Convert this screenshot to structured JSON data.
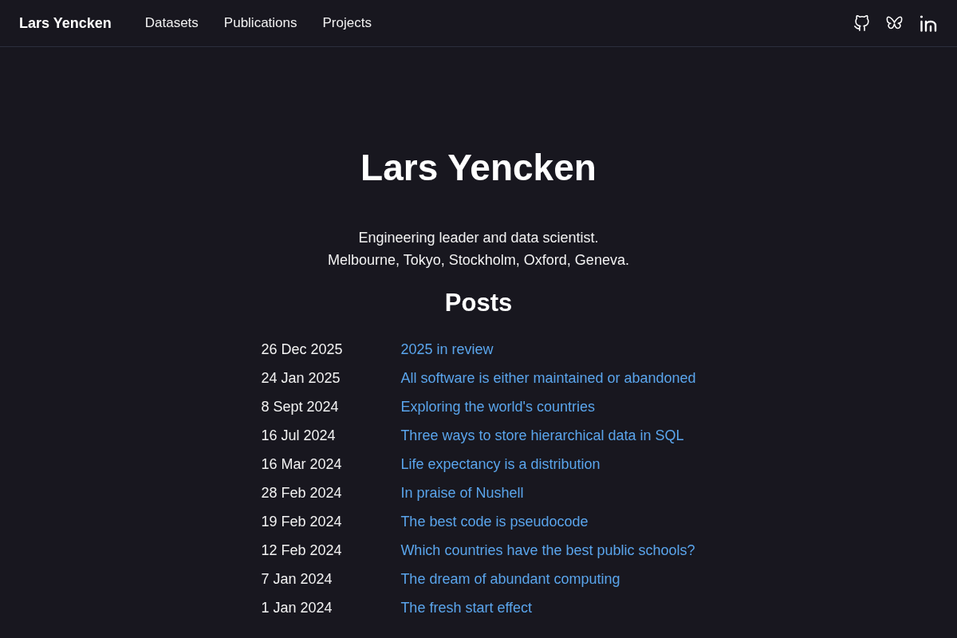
{
  "header": {
    "brand": "Lars Yencken",
    "nav": [
      {
        "label": "Datasets"
      },
      {
        "label": "Publications"
      },
      {
        "label": "Projects"
      }
    ],
    "social": [
      {
        "kind": "github"
      },
      {
        "kind": "butterfly"
      },
      {
        "kind": "linkedin"
      }
    ]
  },
  "hero": {
    "title": "Lars Yencken",
    "lines": [
      "Engineering leader and data scientist.",
      "Melbourne, Tokyo, Stockholm, Oxford, Geneva."
    ]
  },
  "posts": {
    "heading": "Posts",
    "items": [
      {
        "date": "26 Dec 2025",
        "title": "2025 in review"
      },
      {
        "date": "24 Jan 2025",
        "title": "All software is either maintained or abandoned"
      },
      {
        "date": "8 Sept 2024",
        "title": "Exploring the world's countries"
      },
      {
        "date": "16 Jul 2024",
        "title": "Three ways to store hierarchical data in SQL"
      },
      {
        "date": "16 Mar 2024",
        "title": "Life expectancy is a distribution"
      },
      {
        "date": "28 Feb 2024",
        "title": "In praise of Nushell"
      },
      {
        "date": "19 Feb 2024",
        "title": "The best code is pseudocode"
      },
      {
        "date": "12 Feb 2024",
        "title": "Which countries have the best public schools?"
      },
      {
        "date": "7 Jan 2024",
        "title": "The dream of abundant computing"
      },
      {
        "date": "1 Jan 2024",
        "title": "The fresh start effect"
      }
    ]
  }
}
